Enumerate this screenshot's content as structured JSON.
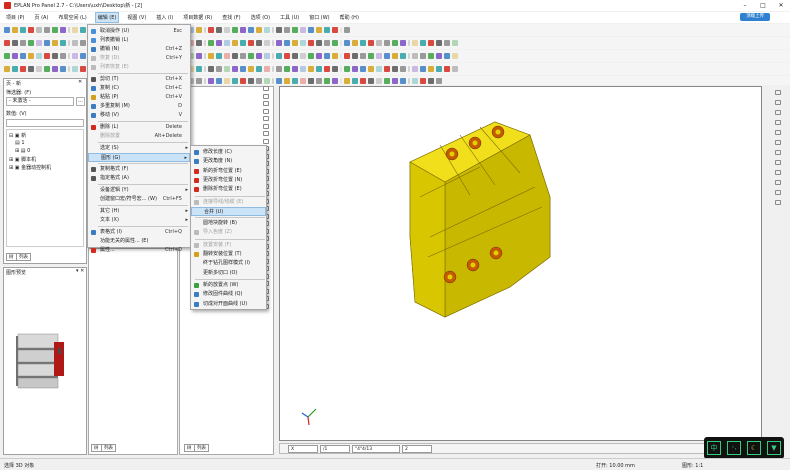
{
  "window": {
    "title": "EPLAN Pro Panel 2.7 - C:\\Users\\uxh\\Desktop\\新 - [2]",
    "minimize": "–",
    "maximize": "□",
    "close": "✕"
  },
  "menubar": [
    "项目 (P)",
    "页 (A)",
    "布局空间 (L)",
    "编辑 (E)",
    "视图 (V)",
    "插入 (I)",
    "项目数据 (R)",
    "查找 (F)",
    "选项 (O)",
    "工具 (U)",
    "窗口 (W)",
    "帮助 (H)"
  ],
  "login": "顶端上传",
  "left": {
    "title": "页 - 新",
    "filter_label": "筛选器: (F)",
    "filter_value": "- 未激活 -",
    "search_label": "数值: (V)",
    "tree": [
      "新",
      "1",
      "0",
      "脚本机",
      "金器动控制机"
    ],
    "tabs": [
      "树",
      "列表"
    ],
    "preview_title": "图形预览"
  },
  "mid": {
    "tabs": [
      "树",
      "列表"
    ]
  },
  "canvas": {
    "tabs": [
      "X",
      "/1",
      "\"4\"4/13",
      "2"
    ]
  },
  "edit_menu": [
    {
      "label": "取消操作 (U)",
      "shortcut": "Esc",
      "icon": "#4a90d9",
      "state": "normal"
    },
    {
      "label": "列表撤销 (L)",
      "shortcut": "",
      "icon": "#4a90d9",
      "state": "normal"
    },
    {
      "label": "撤销 (N)",
      "shortcut": "Ctrl+Z",
      "icon": "#3a7cc2",
      "state": "normal"
    },
    {
      "label": "恢复 (D)",
      "shortcut": "Ctrl+Y",
      "icon": "#bbbbbb",
      "state": "disabled"
    },
    {
      "label": "列表恢复 (E)",
      "shortcut": "",
      "icon": "#bbbbbb",
      "state": "disabled"
    },
    {
      "label": "剪切 (T)",
      "shortcut": "Ctrl+X",
      "icon": "#555555",
      "state": "normal"
    },
    {
      "label": "复制 (C)",
      "shortcut": "Ctrl+C",
      "icon": "#3a7cc2",
      "state": "normal"
    },
    {
      "label": "粘贴 (P)",
      "shortcut": "Ctrl+V",
      "icon": "#d4a017",
      "state": "normal"
    },
    {
      "label": "多重复制 (M)",
      "shortcut": "D",
      "icon": "#3a7cc2",
      "state": "normal"
    },
    {
      "label": "移动 (V)",
      "shortcut": "V",
      "icon": "#3a7cc2",
      "state": "normal"
    },
    {
      "label": "删除 (L)",
      "shortcut": "Delete",
      "icon": "#d42a1e",
      "state": "normal"
    },
    {
      "label": "删除放置",
      "shortcut": "Alt+Delete",
      "icon": "",
      "state": "disabled"
    },
    {
      "label": "选定 (S)",
      "shortcut": "",
      "icon": "",
      "state": "submenu"
    },
    {
      "label": "图形 (G)",
      "shortcut": "",
      "icon": "",
      "state": "highlight"
    },
    {
      "label": "复制格式 (F)",
      "shortcut": "",
      "icon": "#555555",
      "state": "normal"
    },
    {
      "label": "指定格式 (A)",
      "shortcut": "",
      "icon": "#555555",
      "state": "normal"
    },
    {
      "label": "设备逻辑 (Y)",
      "shortcut": "",
      "icon": "",
      "state": "submenu"
    },
    {
      "label": "创建窗口宏/符号宏... (W)",
      "shortcut": "Ctrl+F5",
      "icon": "",
      "state": "normal"
    },
    {
      "label": "其它 (H)",
      "shortcut": "",
      "icon": "",
      "state": "submenu"
    },
    {
      "label": "文本 (X)",
      "shortcut": "",
      "icon": "",
      "state": "submenu"
    },
    {
      "label": "表格式 (I)",
      "shortcut": "Ctrl+Q",
      "icon": "#3a7cc2",
      "state": "normal"
    },
    {
      "label": "功能无关的属性... (E)",
      "shortcut": "",
      "icon": "",
      "state": "normal"
    },
    {
      "label": "属性...",
      "shortcut": "Ctrl+D",
      "icon": "#d42a1e",
      "state": "normal"
    }
  ],
  "graphics_submenu": [
    {
      "label": "修改长度 (C)",
      "icon": "#3a7cc2",
      "state": "normal"
    },
    {
      "label": "更改角度 (N)",
      "icon": "#3a7cc2",
      "state": "normal"
    },
    {
      "label": "新的折弯位置 (E)",
      "icon": "#d42a1e",
      "state": "normal"
    },
    {
      "label": "更改折弯位置 (N)",
      "icon": "#d42a1e",
      "state": "normal"
    },
    {
      "label": "删除折弯位置 (E)",
      "icon": "#d42a1e",
      "state": "normal"
    },
    {
      "label": "连接导线/线缆 (E)",
      "icon": "#bbbbbb",
      "state": "disabled"
    },
    {
      "label": "合并 (U)",
      "icon": "",
      "state": "highlight"
    },
    {
      "label": "圆地块旋转 (B)",
      "icon": "",
      "state": "normal"
    },
    {
      "label": "导入色度 (Z)",
      "icon": "#bbbbbb",
      "state": "disabled"
    },
    {
      "label": "放置安装 (F)",
      "icon": "#bbbbbb",
      "state": "disabled"
    },
    {
      "label": "翻转安装位置 (T)",
      "icon": "#d4a017",
      "state": "normal"
    },
    {
      "label": "终于钻孔图样模式 (I)",
      "icon": "",
      "state": "normal"
    },
    {
      "label": "更新多切口 (O)",
      "icon": "",
      "state": "normal"
    },
    {
      "label": "新的放置点 (W)",
      "icon": "#3aa040",
      "state": "normal"
    },
    {
      "label": "修改固件曲线 (Q)",
      "icon": "#3a7cc2",
      "state": "normal"
    },
    {
      "label": "切成对开面曲线 (U)",
      "icon": "#3a7cc2",
      "state": "normal"
    }
  ],
  "status": {
    "left": "选择 3D 对象",
    "grid": "打开: 10.00 mm",
    "scale": "图形: 1:1"
  },
  "colors": {
    "accent": "#2f80d0",
    "model": "#e2d100",
    "model_dark": "#b8a600",
    "highlight": "#cbe3f7",
    "brand_red": "#d42a1e"
  }
}
